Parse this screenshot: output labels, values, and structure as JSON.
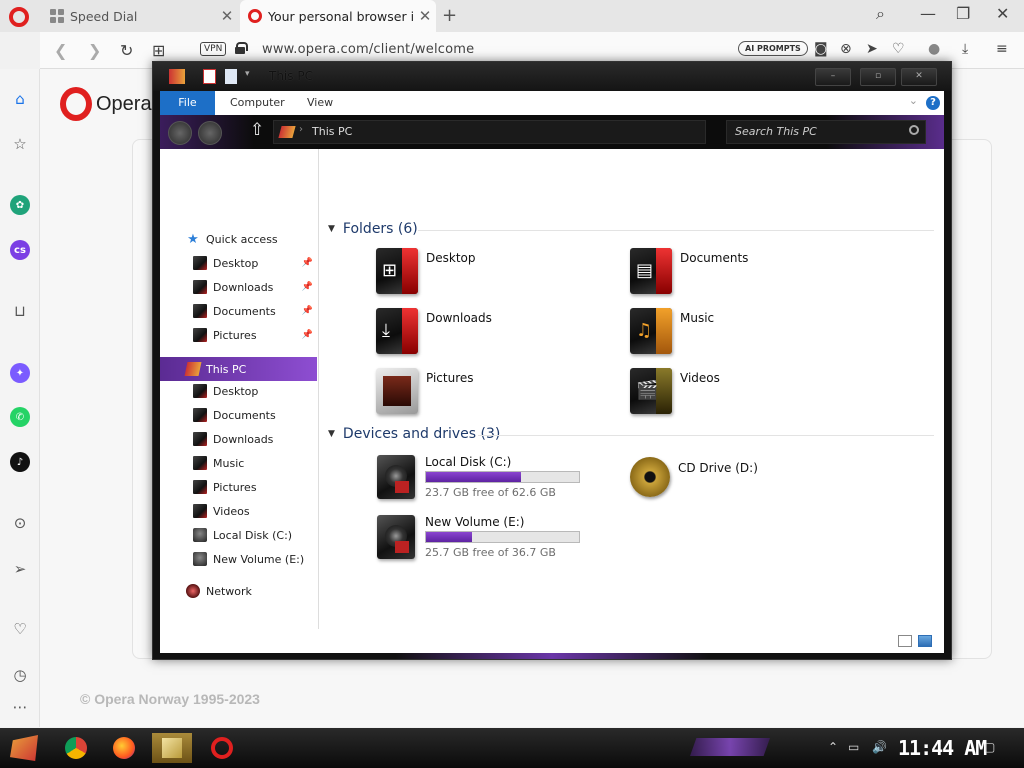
{
  "browser": {
    "tabs": [
      {
        "label": "Speed Dial"
      },
      {
        "label": "Your personal browser is"
      }
    ],
    "vpn_label": "VPN",
    "url": "www.opera.com/client/welcome",
    "ai_prompts_label": "AI PROMPTS",
    "accent_color": "#e0201f"
  },
  "opera_page": {
    "logo_text": "Opera",
    "copyright": "© Opera Norway 1995-2023"
  },
  "explorer": {
    "title": "This PC",
    "ribbon_tabs": [
      "File",
      "Computer",
      "View"
    ],
    "help_label": "?",
    "breadcrumb": "This PC",
    "search_placeholder": "Search This PC",
    "nav": {
      "quick_access": "Quick access",
      "quick_items": [
        "Desktop",
        "Downloads",
        "Documents",
        "Pictures"
      ],
      "this_pc": "This PC",
      "pc_items": [
        "Desktop",
        "Documents",
        "Downloads",
        "Music",
        "Pictures",
        "Videos",
        "Local Disk (C:)",
        "New Volume (E:)"
      ],
      "network": "Network"
    },
    "folders_header": "Folders (6)",
    "folders": [
      "Desktop",
      "Documents",
      "Downloads",
      "Music",
      "Pictures",
      "Videos"
    ],
    "drives_header": "Devices and drives (3)",
    "drives": [
      {
        "name": "Local Disk (C:)",
        "free": "23.7 GB free of 62.6 GB",
        "used_fraction": 0.62
      },
      {
        "name": "CD Drive (D:)"
      },
      {
        "name": "New Volume (E:)",
        "free": "25.7 GB free of 36.7 GB",
        "used_fraction": 0.3
      }
    ],
    "drive_bar_color": "#7a35c0",
    "selection_color": "#7a3dbf"
  },
  "taskbar": {
    "clock": "11:44 AM"
  }
}
